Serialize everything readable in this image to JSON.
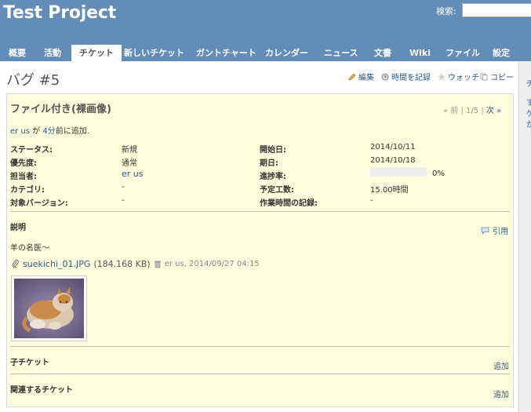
{
  "header": {
    "project_title": "Test Project",
    "search_label": "検索:",
    "search_value": ""
  },
  "menu": {
    "tabs": [
      {
        "label": "概要",
        "selected": false
      },
      {
        "label": "活動",
        "selected": false
      },
      {
        "label": "チケット",
        "selected": true
      },
      {
        "label": "新しいチケット",
        "selected": false
      },
      {
        "label": "ガントチャート",
        "selected": false
      },
      {
        "label": "カレンダー",
        "selected": false
      },
      {
        "label": "ニュース",
        "selected": false
      },
      {
        "label": "文書",
        "selected": false
      },
      {
        "label": "Wiki",
        "selected": false
      },
      {
        "label": "ファイル",
        "selected": false
      },
      {
        "label": "設定",
        "selected": false
      }
    ]
  },
  "issue": {
    "title": "バグ #5",
    "subject": "ファイル付き(裸画像)",
    "actions": {
      "edit": "編集",
      "log_time": "時間を記録",
      "watch": "ウォッチ",
      "copy": "コピー"
    },
    "pagination": {
      "prev": "« 前",
      "sep1": "|",
      "position": "1/5",
      "sep2": "|",
      "next": "次 »"
    },
    "author": {
      "name": "er us",
      "mid": "が",
      "time": "4分",
      "suffix": "前に追加."
    },
    "attributes_left": [
      {
        "label": "ステータス:",
        "value": "新規",
        "link": false
      },
      {
        "label": "優先度:",
        "value": "通常",
        "link": false
      },
      {
        "label": "担当者:",
        "value": "er us",
        "link": true
      },
      {
        "label": "カテゴリ:",
        "value": "-",
        "link": false
      },
      {
        "label": "対象バージョン:",
        "value": "-",
        "link": false
      }
    ],
    "attributes_right": [
      {
        "label": "開始日:",
        "value": "2014/10/11"
      },
      {
        "label": "期日:",
        "value": "2014/10/18"
      },
      {
        "label": "進捗率:",
        "value": "0%"
      },
      {
        "label": "予定工数:",
        "value": "15.00時間"
      },
      {
        "label": "作業時間の記録:",
        "value": "-"
      }
    ],
    "progress_fraction": 0.0,
    "description": {
      "title": "説明",
      "quote": "引用",
      "body": "羊の名医～"
    },
    "attachment": {
      "filename": "suekichi_01.JPG",
      "size": "(184.168 KB)",
      "author_date": "er us, 2014/09/27 04:15"
    },
    "subtasks": {
      "title": "子チケット",
      "add": "追加"
    },
    "relations": {
      "title": "関連するチケット",
      "add": "追加"
    }
  },
  "sidebar": {
    "glyphs": [
      "チ",
      "す",
      "ゲ",
      "か"
    ]
  },
  "colors": {
    "header": "#628db6",
    "issue_bg": "#ffffdd",
    "link": "#2a5a8a",
    "progress_done": "#bae0ba"
  }
}
